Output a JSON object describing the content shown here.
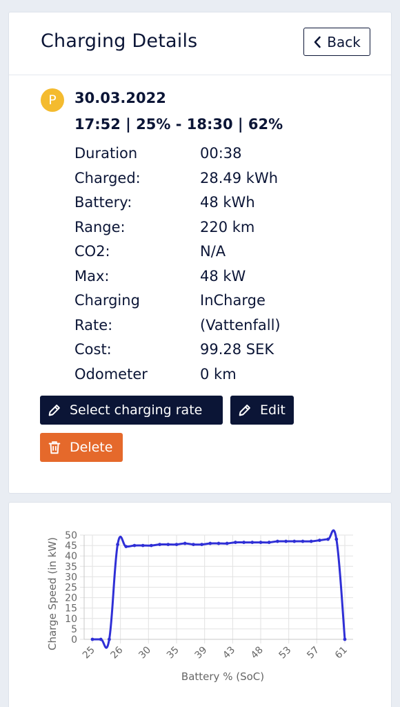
{
  "header": {
    "title": "Charging Details",
    "back_label": "Back"
  },
  "session": {
    "badge": "P",
    "date": "30.03.2022",
    "summary": "17:52 | 25% - 18:30 | 62%",
    "details": [
      {
        "label": "Duration",
        "value": "00:38"
      },
      {
        "label": "Charged:",
        "value": "28.49 kWh"
      },
      {
        "label": "Battery:",
        "value": "48 kWh"
      },
      {
        "label": "Range:",
        "value": "220 km"
      },
      {
        "label": "CO2:",
        "value": "N/A"
      },
      {
        "label": "Max:",
        "value": "48 kW"
      },
      {
        "label": "Charging",
        "value": "InCharge"
      },
      {
        "label": "Rate:",
        "value": "(Vattenfall)"
      },
      {
        "label": "Cost:",
        "value": "99.28 SEK"
      },
      {
        "label": "Odometer",
        "value": "0 km"
      }
    ]
  },
  "actions": {
    "select_rate_label": "Select charging rate",
    "edit_label": "Edit",
    "delete_label": "Delete"
  },
  "icons": {
    "back": "chevron-left-icon",
    "edit": "pencil-icon",
    "delete": "trash-icon"
  },
  "colors": {
    "navy": "#0b1536",
    "badge": "#f4bb2f",
    "delete": "#e5692b",
    "series": "#2f2fd6",
    "grid": "#e2e2e2"
  },
  "chart_data": {
    "type": "line",
    "title": "",
    "xlabel": "Battery % (SoC)",
    "ylabel": "Charge Speed (in kW)",
    "ylim": [
      0,
      50
    ],
    "yticks": [
      0,
      5,
      10,
      15,
      20,
      25,
      30,
      35,
      40,
      45,
      50
    ],
    "xtick_labels": [
      "25",
      "26",
      "30",
      "35",
      "39",
      "43",
      "48",
      "53",
      "57",
      "61"
    ],
    "grid": true,
    "legend": "none",
    "series": [
      {
        "x": [
          "25",
          "25",
          "25",
          "26",
          "28",
          "29",
          "30",
          "31",
          "33",
          "34",
          "35",
          "37",
          "38",
          "39",
          "41",
          "42",
          "43",
          "45",
          "46",
          "48",
          "49",
          "50",
          "52",
          "53",
          "54",
          "56",
          "57",
          "58",
          "60",
          "61",
          "62"
        ],
        "values": [
          0,
          0,
          0,
          45.5,
          44.5,
          45,
          45,
          45,
          45.5,
          45.5,
          45.5,
          46,
          45.5,
          45.5,
          46,
          46,
          46,
          46.5,
          46.5,
          46.5,
          46.5,
          46.5,
          47,
          47,
          47,
          47,
          47,
          47.5,
          48,
          48,
          0
        ]
      }
    ]
  }
}
